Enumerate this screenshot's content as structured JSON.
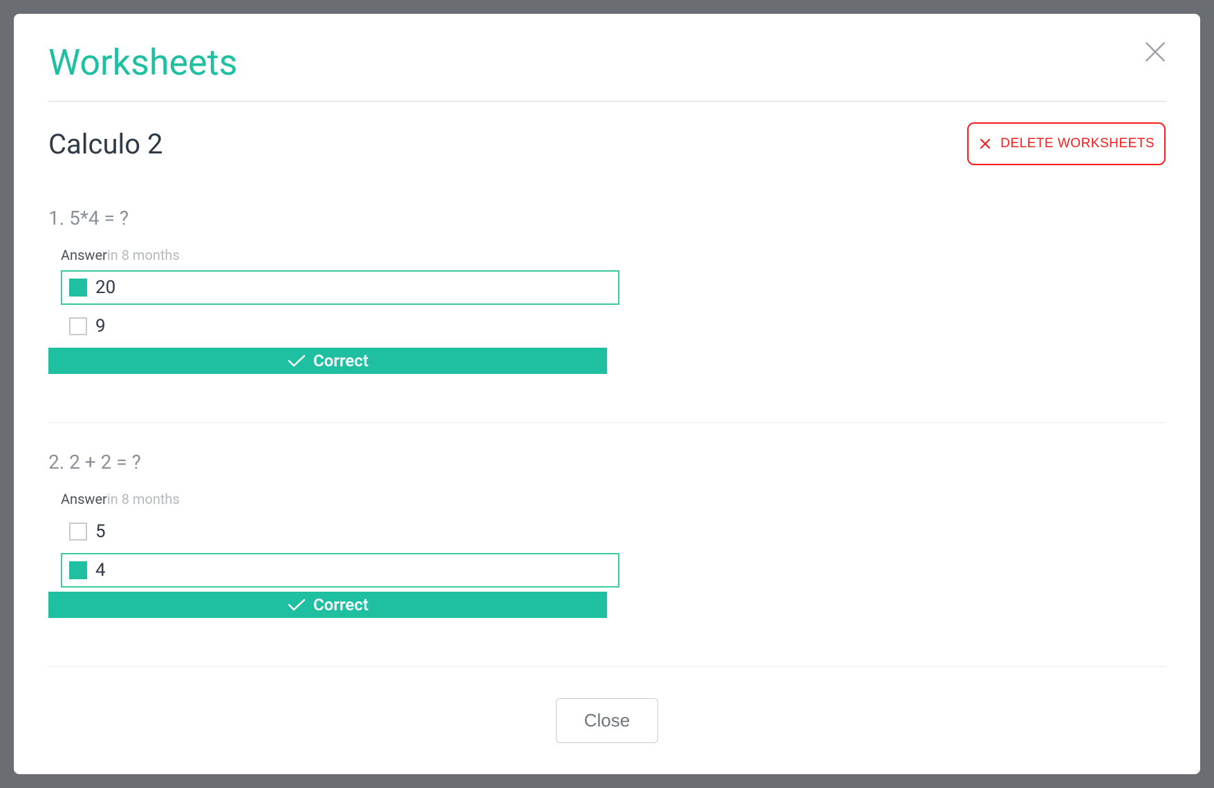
{
  "title": "Worksheets",
  "worksheet_name": "Calculo 2",
  "delete_label": "DELETE WORKSHEETS",
  "close_label": "Close",
  "answer_label": "Answer",
  "questions": [
    {
      "number": "1.",
      "text": "5*4 = ?",
      "time": "in 8 months",
      "options": [
        {
          "label": "20",
          "selected": true
        },
        {
          "label": "9",
          "selected": false
        }
      ],
      "status": "Correct"
    },
    {
      "number": "2.",
      "text": "2 + 2 = ?",
      "time": "in 8 months",
      "options": [
        {
          "label": "5",
          "selected": false
        },
        {
          "label": "4",
          "selected": true
        }
      ],
      "status": "Correct"
    }
  ]
}
